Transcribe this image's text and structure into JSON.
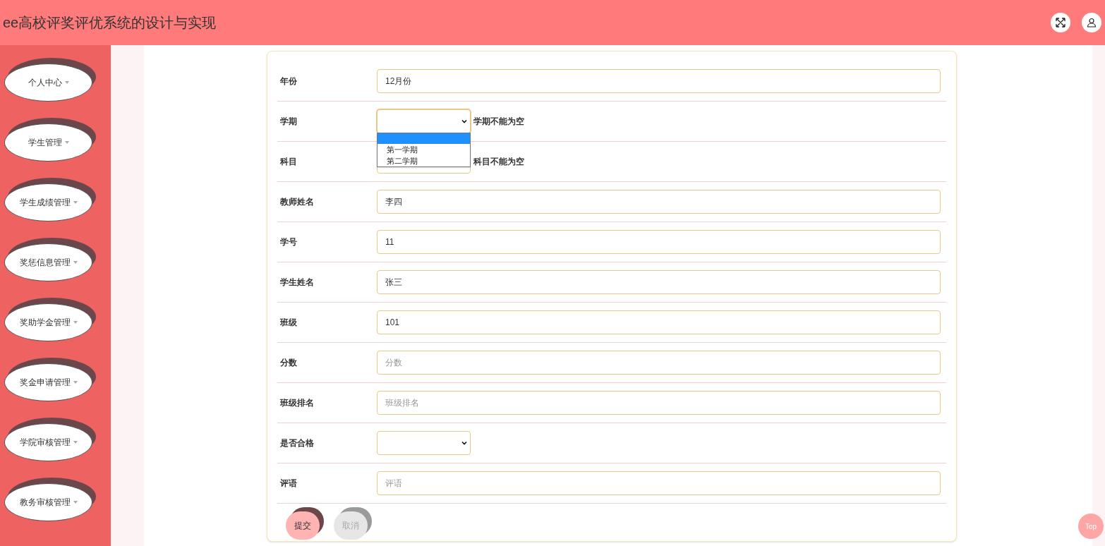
{
  "header": {
    "title": "ee高校评奖评优系统的设计与实现"
  },
  "sidebar": {
    "items": [
      {
        "label": "个人中心"
      },
      {
        "label": "学生管理"
      },
      {
        "label": "学生成绩管理"
      },
      {
        "label": "奖惩信息管理"
      },
      {
        "label": "奖助学金管理"
      },
      {
        "label": "奖金申请管理"
      },
      {
        "label": "学院审核管理"
      },
      {
        "label": "教务审核管理"
      }
    ]
  },
  "form": {
    "fields": [
      {
        "kind": "input",
        "label": "年份",
        "value": "12月份"
      },
      {
        "kind": "select",
        "label": "学期",
        "error": "学期不能为空",
        "open": true,
        "blank_highlighted": true,
        "options": [
          {
            "label": "第一学期",
            "selected": false
          },
          {
            "label": "第二学期",
            "selected": false
          }
        ]
      },
      {
        "kind": "select",
        "label": "科目",
        "error": "科目不能为空",
        "open": false
      },
      {
        "kind": "input",
        "label": "教师姓名",
        "value": "李四"
      },
      {
        "kind": "input",
        "label": "学号",
        "value": "11"
      },
      {
        "kind": "input",
        "label": "学生姓名",
        "value": "张三"
      },
      {
        "kind": "input",
        "label": "班级",
        "value": "101"
      },
      {
        "kind": "input",
        "label": "分数",
        "placeholder": "分数"
      },
      {
        "kind": "input",
        "label": "班级排名",
        "placeholder": "班级排名"
      },
      {
        "kind": "select",
        "label": "是否合格",
        "open": false
      },
      {
        "kind": "input",
        "label": "评语",
        "placeholder": "评语"
      }
    ],
    "buttons": [
      {
        "label": "提交",
        "kind": "primary"
      },
      {
        "label": "取消",
        "kind": "secondary"
      }
    ]
  },
  "back_to_top": {
    "label": "Top"
  }
}
